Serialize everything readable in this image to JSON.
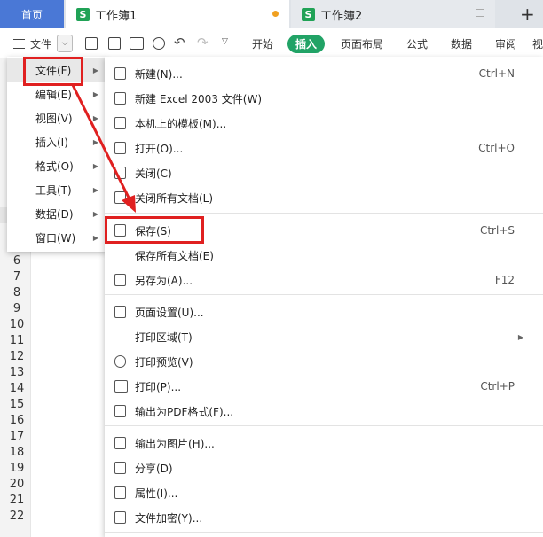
{
  "tabs": {
    "home": "首页",
    "active": "工作簿1",
    "inactive": "工作簿2",
    "app_icon": "S",
    "add": "+"
  },
  "toolbar": {
    "file_menu": "文件",
    "ribbon_tabs": [
      "开始",
      "插入",
      "页面布局",
      "公式",
      "数据",
      "审阅",
      "视"
    ],
    "selected_tab": "插入"
  },
  "left_menu": [
    {
      "label": "文件(F)"
    },
    {
      "label": "编辑(E)"
    },
    {
      "label": "视图(V)"
    },
    {
      "label": "插入(I)"
    },
    {
      "label": "格式(O)"
    },
    {
      "label": "工具(T)"
    },
    {
      "label": "数据(D)"
    },
    {
      "label": "窗口(W)"
    }
  ],
  "file_submenu": [
    {
      "label": "新建(N)...",
      "shortcut": "Ctrl+N",
      "icon": "new-doc-icon"
    },
    {
      "label": "新建 Excel 2003 文件(W)",
      "shortcut": "",
      "icon": "new-doc-icon"
    },
    {
      "label": "本机上的模板(M)...",
      "shortcut": "",
      "icon": "template-icon"
    },
    {
      "label": "打开(O)...",
      "shortcut": "Ctrl+O",
      "icon": "open-icon"
    },
    {
      "label": "关闭(C)",
      "shortcut": "",
      "icon": "close-doc-icon"
    },
    {
      "label": "关闭所有文档(L)",
      "shortcut": "",
      "icon": "close-all-icon"
    },
    {
      "label": "保存(S)",
      "shortcut": "Ctrl+S",
      "icon": "save-icon"
    },
    {
      "label": "保存所有文档(E)",
      "shortcut": "",
      "icon": ""
    },
    {
      "label": "另存为(A)...",
      "shortcut": "F12",
      "icon": "save-as-icon"
    },
    {
      "label": "页面设置(U)...",
      "shortcut": "",
      "icon": "page-setup-icon"
    },
    {
      "label": "打印区域(T)",
      "shortcut": "",
      "icon": ""
    },
    {
      "label": "打印预览(V)",
      "shortcut": "",
      "icon": "print-preview-icon"
    },
    {
      "label": "打印(P)...",
      "shortcut": "Ctrl+P",
      "icon": "print-icon"
    },
    {
      "label": "输出为PDF格式(F)...",
      "shortcut": "",
      "icon": "pdf-icon"
    },
    {
      "label": "输出为图片(H)...",
      "shortcut": "",
      "icon": "image-icon"
    },
    {
      "label": "分享(D)",
      "shortcut": "",
      "icon": "share-icon"
    },
    {
      "label": "属性(I)...",
      "shortcut": "",
      "icon": "properties-icon"
    },
    {
      "label": "文件加密(Y)...",
      "shortcut": "",
      "icon": "encrypt-icon"
    }
  ],
  "row_numbers": [
    "6",
    "7",
    "8",
    "9",
    "10",
    "11",
    "12",
    "13",
    "14",
    "15",
    "16",
    "17",
    "18",
    "19",
    "20",
    "21",
    "22"
  ],
  "partial_text": "图"
}
